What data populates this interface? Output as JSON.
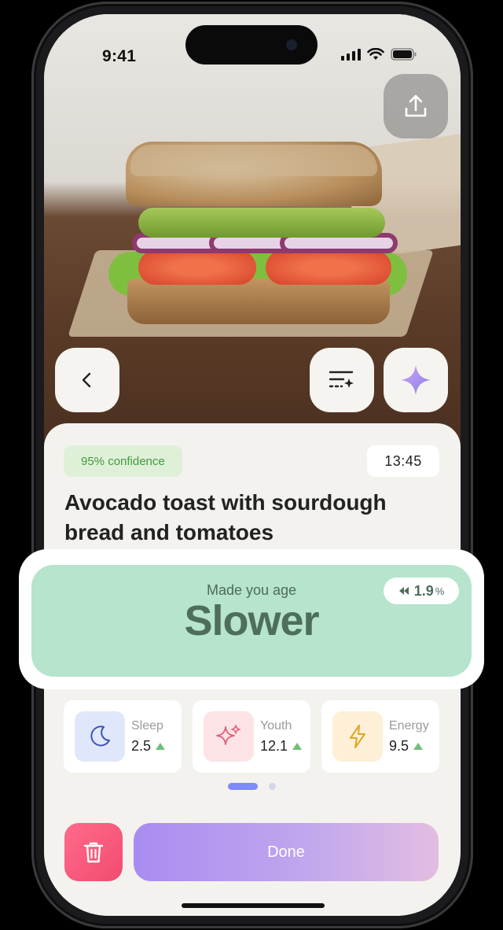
{
  "status_bar": {
    "time": "9:41"
  },
  "meal": {
    "confidence": "95% confidence",
    "time": "13:45",
    "title": "Avocado toast with sourdough bread and tomatoes"
  },
  "impact": {
    "label": "Made you age",
    "verdict": "Slower",
    "change_value": "1.9",
    "change_unit": "%"
  },
  "metrics": [
    {
      "label": "Sleep",
      "value": "2.5",
      "icon": "moon-icon",
      "trend": "up"
    },
    {
      "label": "Youth",
      "value": "12.1",
      "icon": "sparkles-icon",
      "trend": "up"
    },
    {
      "label": "Energy",
      "value": "9.5",
      "icon": "lightning-icon",
      "trend": "up"
    }
  ],
  "pagination": {
    "pages": 2,
    "current": 1
  },
  "actions": {
    "done_label": "Done",
    "delete_icon": "trash-icon"
  },
  "colors": {
    "accent": "#a98cf0",
    "impact_bg": "#b6e4cd",
    "delete": "#f24b72",
    "confidence": "#3f9a3a"
  }
}
